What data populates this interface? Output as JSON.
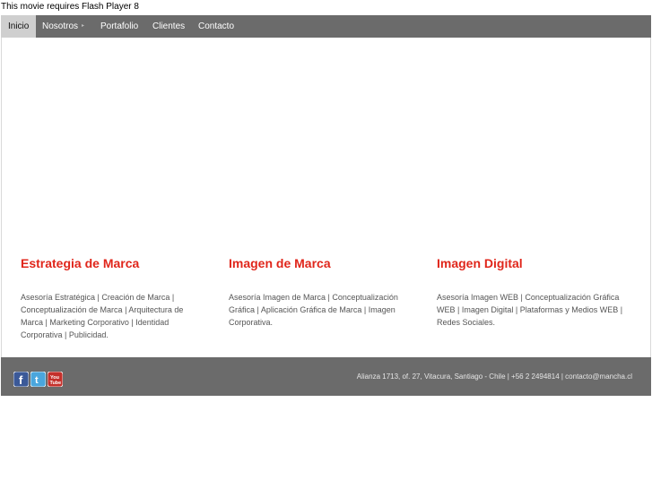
{
  "flash_message": "This movie requires Flash Player 8",
  "nav": {
    "items": [
      {
        "label": "Inicio"
      },
      {
        "label": "Nosotros"
      },
      {
        "label": "Portafolio"
      },
      {
        "label": "Clientes"
      },
      {
        "label": "Contacto"
      }
    ]
  },
  "columns": [
    {
      "title": "Estrategia de Marca",
      "text": "Asesoría Estratégica | Creación de Marca | Conceptualización de Marca | Arquitectura de Marca | Marketing Corporativo | Identidad Corporativa | Publicidad."
    },
    {
      "title": "Imagen de Marca",
      "text": "Asesoría Imagen de Marca | Conceptualización Gráfica | Aplicación Gráfica de Marca | Imagen Corporativa."
    },
    {
      "title": "Imagen Digital",
      "text": "Asesoría Imagen WEB | Conceptualización Gráfica WEB | Imagen Digital | Plataformas y Medios WEB | Redes Sociales."
    }
  ],
  "footer": {
    "social": [
      {
        "icon": "facebook-icon",
        "glyph": "f",
        "color": "#3b5998"
      },
      {
        "icon": "twitter-icon",
        "glyph": "t",
        "color": "#4aa6dd"
      },
      {
        "icon": "youtube-icon",
        "glyph": "You\nTube",
        "color": "#c4302b"
      }
    ],
    "address": "Alianza 1713, of. 27, Vitacura, Santiago - Chile | +56 2 2494814 | contacto@mancha.cl"
  },
  "colors": {
    "accent": "#e0261b",
    "bar": "#6b6b6b",
    "active_tab": "#cfcfcf"
  }
}
